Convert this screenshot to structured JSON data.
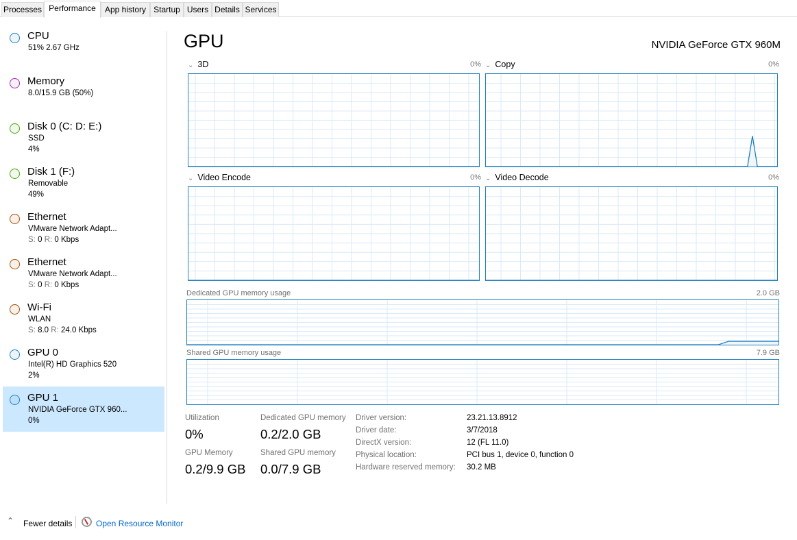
{
  "tabs": [
    "Processes",
    "Performance",
    "App history",
    "Startup",
    "Users",
    "Details",
    "Services"
  ],
  "selected_tab": "Performance",
  "sidebar": {
    "items": [
      {
        "title": "CPU",
        "line1": "51%  2.67 GHz",
        "line2": "",
        "color": "#1e7fc0"
      },
      {
        "title": "Memory",
        "line1": "8.0/15.9 GB (50%)",
        "line2": "",
        "color": "#9b2fae"
      },
      {
        "title": "Disk 0 (C: D: E:)",
        "line1": "SSD",
        "line2": "4%",
        "color": "#4da60c"
      },
      {
        "title": "Disk 1 (F:)",
        "line1": "Removable",
        "line2": "49%",
        "color": "#4da60c"
      },
      {
        "title": "Ethernet",
        "line1": "VMware Network Adapt...",
        "s": "0",
        "r": "0 Kbps",
        "color": "#a74f01"
      },
      {
        "title": "Ethernet",
        "line1": "VMware Network Adapt...",
        "s": "0",
        "r": "0 Kbps",
        "color": "#a74f01"
      },
      {
        "title": "Wi-Fi",
        "line1": "WLAN",
        "s": "8.0",
        "r": "24.0 Kbps",
        "color": "#a74f01"
      },
      {
        "title": "GPU 0",
        "line1": "Intel(R) HD Graphics 520",
        "line2": "2%",
        "color": "#1e7fc0"
      },
      {
        "title": "GPU 1",
        "line1": "NVIDIA GeForce GTX 960...",
        "line2": "0%",
        "color": "#1e7fc0",
        "selected": true
      }
    ],
    "s_label": "S:",
    "r_label": "R:"
  },
  "main": {
    "title": "GPU",
    "model": "NVIDIA GeForce GTX 960M",
    "engines": [
      {
        "name": "3D",
        "percent": "0%",
        "history": []
      },
      {
        "name": "Copy",
        "percent": "0%",
        "history": {
          "53": 0,
          "54": 33,
          "55": 0
        }
      },
      {
        "name": "Video Encode",
        "percent": "0%",
        "history": []
      },
      {
        "name": "Video Decode",
        "percent": "0%",
        "history": []
      }
    ],
    "dedicated": {
      "label": "Dedicated GPU memory usage",
      "max": "2.0 GB",
      "max_gb": 2.0,
      "history_start_index": 53,
      "level_gb": 0.15
    },
    "shared": {
      "label": "Shared GPU memory usage",
      "max": "7.9 GB"
    },
    "stats": {
      "utilization_label": "Utilization",
      "utilization": "0%",
      "dedicated_label": "Dedicated GPU memory",
      "dedicated": "0.2/2.0 GB",
      "gpu_memory_label": "GPU Memory",
      "gpu_memory": "0.2/9.9 GB",
      "shared_label": "Shared GPU memory",
      "shared": "0.0/7.9 GB"
    },
    "properties": [
      {
        "label": "Driver version:",
        "value": "23.21.13.8912"
      },
      {
        "label": "Driver date:",
        "value": "3/7/2018"
      },
      {
        "label": "DirectX version:",
        "value": "12 (FL 11.0)"
      },
      {
        "label": "Physical location:",
        "value": "PCI bus 1, device 0, function 0"
      },
      {
        "label": "Hardware reserved memory:",
        "value": "30.2 MB"
      }
    ]
  },
  "footer": {
    "fewer_details": "Fewer details",
    "open_resource_monitor": "Open Resource Monitor"
  },
  "colors": {
    "accent": "#1e7fc0",
    "grid": "#d9eaf7",
    "selected_bg": "#cce8ff",
    "link": "#0066cc"
  }
}
